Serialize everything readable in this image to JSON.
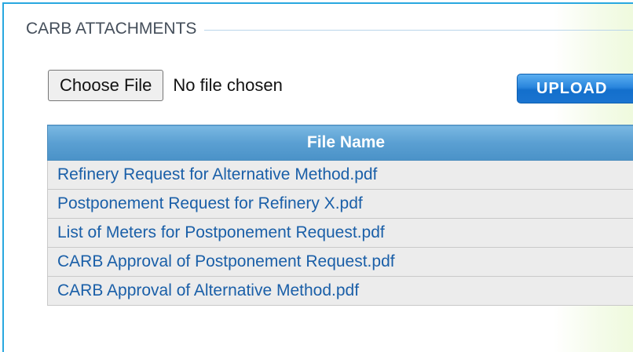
{
  "section": {
    "legend": "CARB ATTACHMENTS"
  },
  "file_input": {
    "button_label": "Choose File",
    "status": "No file chosen"
  },
  "upload": {
    "label": "UPLOAD"
  },
  "table": {
    "header": "File Name",
    "rows": [
      "Refinery Request for Alternative Method.pdf",
      "Postponement Request for Refinery X.pdf",
      "List of Meters for Postponement Request.pdf",
      "CARB Approval of Postponement Request.pdf",
      "CARB Approval of Alternative Method.pdf"
    ]
  },
  "colors": {
    "border_accent": "#29a8e0",
    "header_blue": "#5a9fd2",
    "link_blue": "#1a5fa8",
    "upload_blue": "#2a86dd"
  }
}
